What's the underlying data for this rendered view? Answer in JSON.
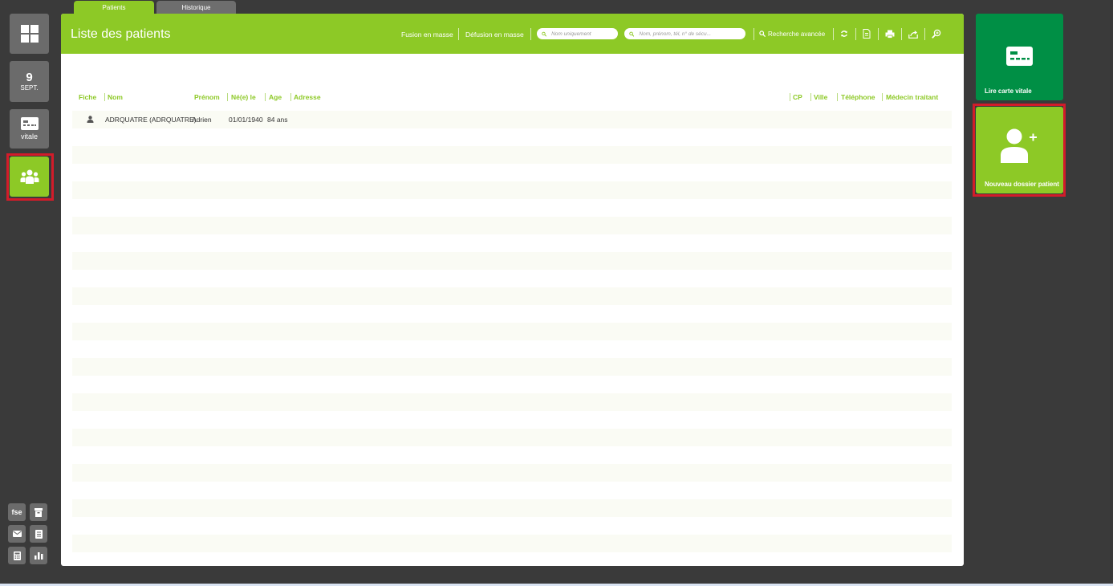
{
  "tabs": [
    {
      "label": "Patients",
      "active": true
    },
    {
      "label": "Historique",
      "active": false
    }
  ],
  "sidebar": {
    "date_day": "9",
    "date_month": "SEPT.",
    "vitale_label": "vitale",
    "mini_fse": "fse"
  },
  "header": {
    "title": "Liste des patients",
    "fusion": "Fusion en masse",
    "defusion": "Défusion en masse",
    "search1_placeholder": "Nom uniquement",
    "search2_placeholder": "Nom, prénom, tél, n° de sécu...",
    "advanced": "Recherche avancée"
  },
  "columns": {
    "fiche": "Fiche",
    "nom": "Nom",
    "prenom": "Prénom",
    "ne_le": "Né(e) le",
    "age": "Age",
    "adresse": "Adresse",
    "cp": "CP",
    "ville": "Ville",
    "telephone": "Téléphone",
    "medecin": "Médecin traitant"
  },
  "patients": [
    {
      "nom": "ADRQUATRE (ADRQUATRE)",
      "prenom": "Adrien",
      "ne_le": "01/01/1940",
      "age": "84 ans"
    }
  ],
  "right": {
    "vitale_label": "Lire carte vitale",
    "new_label": "Nouveau dossier patient"
  },
  "colors": {
    "accent": "#8dc926",
    "dark_green": "#008f45",
    "highlight": "#d21c2a",
    "background": "#3a3a3a"
  }
}
